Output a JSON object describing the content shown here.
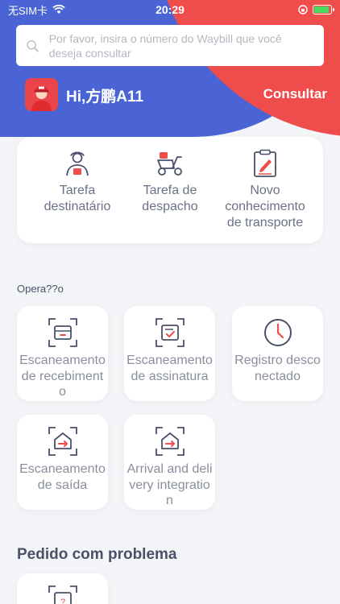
{
  "status_bar": {
    "carrier": "无SIM卡",
    "time": "20:29"
  },
  "search": {
    "placeholder": "Por favor, insira o número do Waybill que você deseja consultar"
  },
  "user": {
    "greeting": "Hi,方鹏A11",
    "action": "Consultar"
  },
  "tasks": [
    {
      "label": "Tarefa destinatário",
      "icon": "courier-person-icon"
    },
    {
      "label": "Tarefa de despacho",
      "icon": "delivery-scooter-icon"
    },
    {
      "label": "Novo conhecimento de transporte",
      "icon": "clipboard-edit-icon"
    }
  ],
  "operations": {
    "label": "Opera??o",
    "items": [
      {
        "label": "Escaneamento de recebimento",
        "icon": "scan-box-icon"
      },
      {
        "label": "Escaneamento de assinatura",
        "icon": "scan-sign-icon"
      },
      {
        "label": "Registro desconectado",
        "icon": "clock-icon"
      },
      {
        "label": "Escaneamento de saída",
        "icon": "scan-outbound-icon"
      },
      {
        "label": "Arrival and delivery integration",
        "icon": "scan-arrival-icon"
      }
    ]
  },
  "problem": {
    "title": "Pedido com problema",
    "items": [
      {
        "label": "",
        "icon": "scan-problem-icon"
      }
    ]
  },
  "colors": {
    "blue": "#4a64d6",
    "red": "#ef4c4c",
    "text": "#6b7287"
  }
}
